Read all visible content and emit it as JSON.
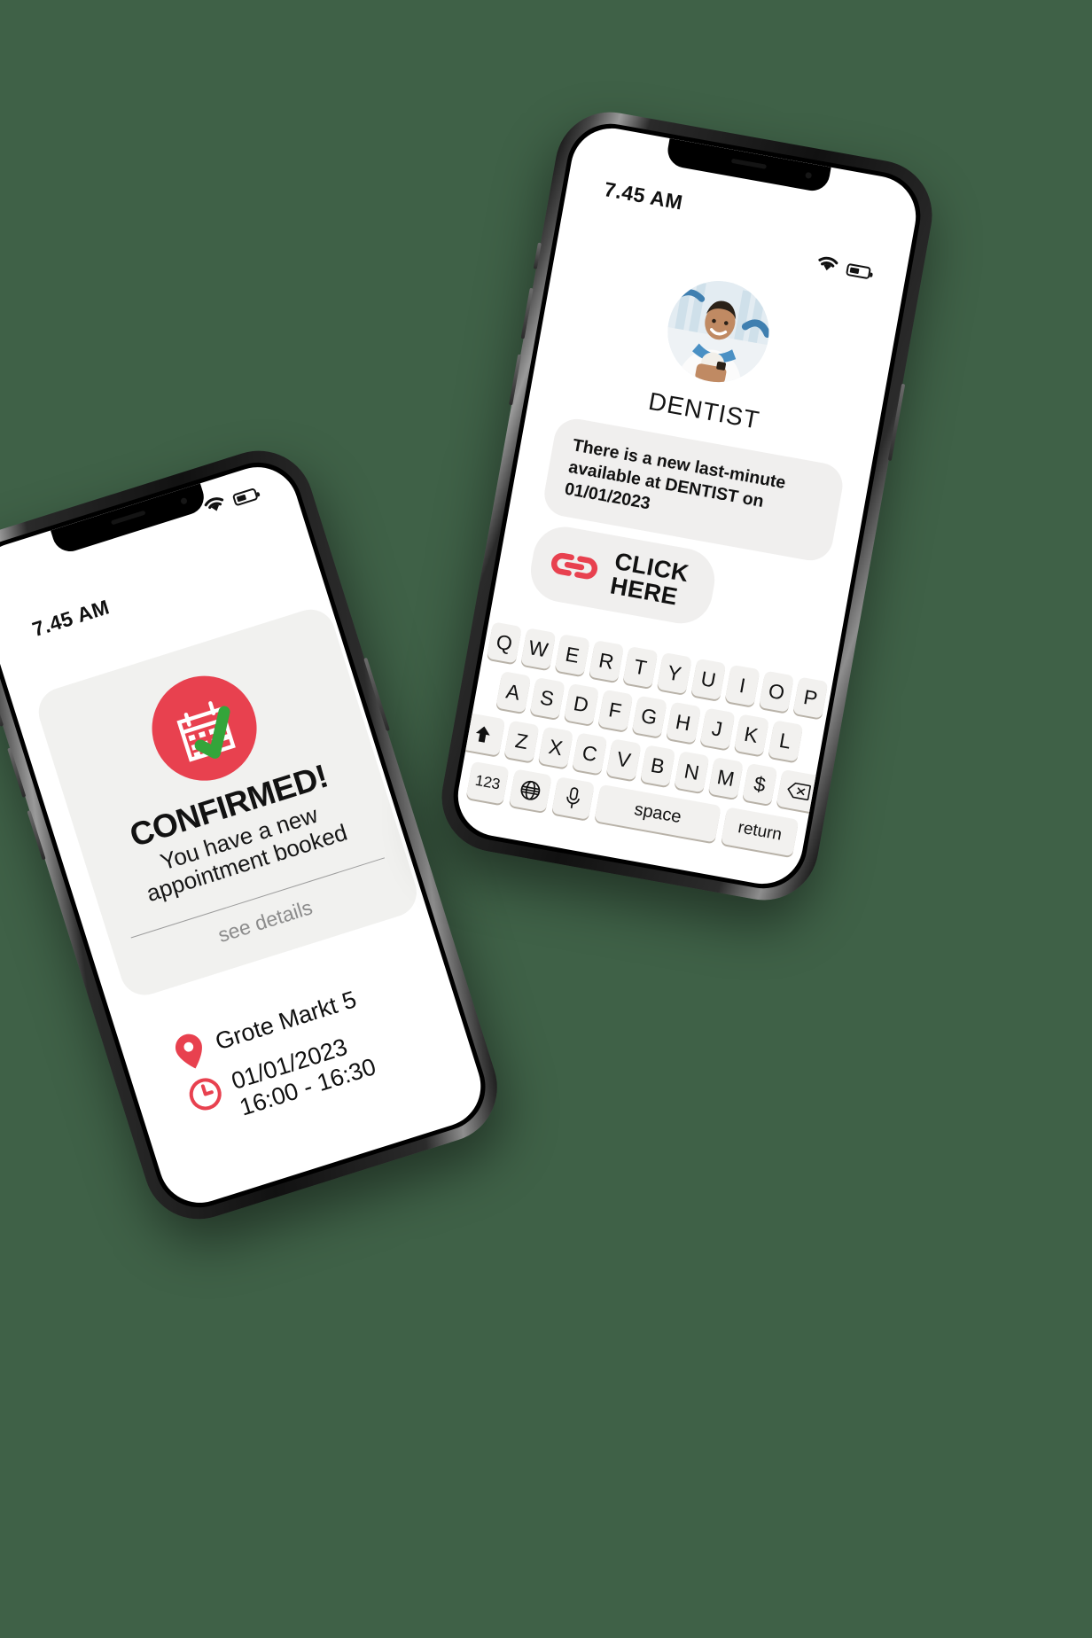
{
  "colors": {
    "background": "#3f6147",
    "accent_red": "#e8414f",
    "check_green": "#34a53a",
    "card_grey": "#f1f1ef",
    "bubble_grey": "#f0efee",
    "key_grey": "#f2f1ef",
    "muted_text": "#8c8c8c"
  },
  "phone_left": {
    "name": "confirmation-phone",
    "status": {
      "time": "7.45 AM",
      "wifi_icon": "wifi-icon",
      "battery_icon": "battery-icon"
    },
    "card": {
      "icon": "calendar-check-icon",
      "title": "CONFIRMED!",
      "subtitle": "You have a new\nappointment booked",
      "link": "see details"
    },
    "details": [
      {
        "icon": "location-pin-icon",
        "text": "Grote Markt 5"
      },
      {
        "icon": "clock-icon",
        "text": "01/01/2023\n16:00 - 16:30"
      }
    ]
  },
  "phone_right": {
    "name": "chat-phone",
    "status": {
      "time": "7.45 AM",
      "wifi_icon": "wifi-icon",
      "battery_icon": "battery-icon"
    },
    "contact": {
      "avatar": "dentist-avatar-photo",
      "name": "DENTIST"
    },
    "message": "There is a new last-minute available at DENTIST on 01/01/2023",
    "cta": {
      "icon": "chain-link-icon",
      "label": "CLICK\nHERE"
    },
    "keyboard": {
      "row1": [
        "Q",
        "W",
        "E",
        "R",
        "T",
        "Y",
        "U",
        "I",
        "O",
        "P"
      ],
      "row2": [
        "A",
        "S",
        "D",
        "F",
        "G",
        "H",
        "J",
        "K",
        "L"
      ],
      "row3": [
        "Z",
        "X",
        "C",
        "V",
        "B",
        "N",
        "M",
        "$"
      ],
      "shift_icon": "shift-arrow-icon",
      "backspace_icon": "backspace-icon",
      "numbers_key": "123",
      "globe_icon": "globe-icon",
      "mic_icon": "microphone-icon",
      "space_key": "space",
      "return_key": "return"
    }
  }
}
